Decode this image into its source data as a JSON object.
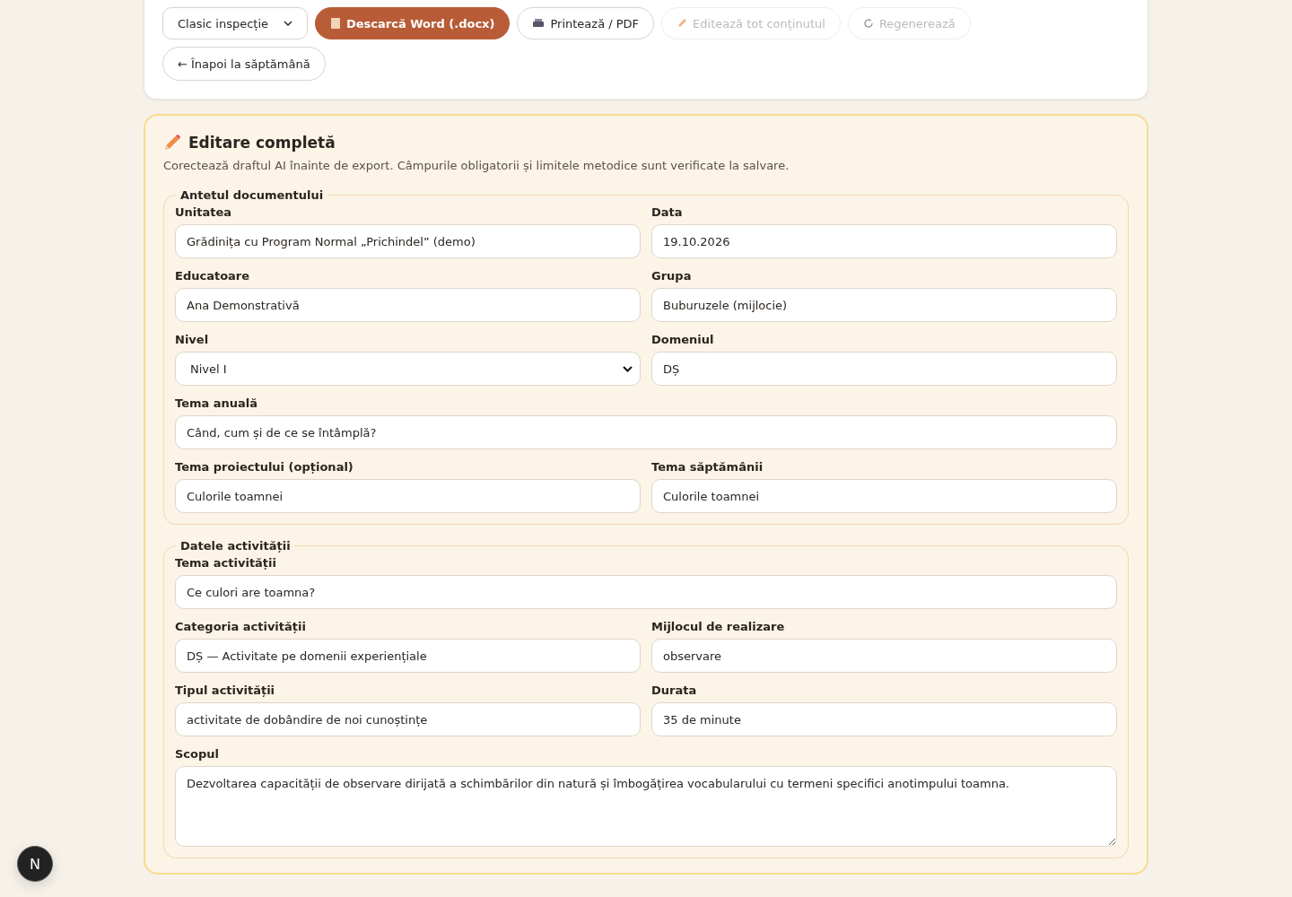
{
  "toolbar": {
    "select": "Clasic inspecție",
    "buttons": [
      {
        "label": "Descarcă Word (.docx)",
        "kind": "primary",
        "disabled": false
      },
      {
        "label": "Printează / PDF",
        "kind": "print",
        "disabled": false
      },
      {
        "label": "Editează tot conținutul",
        "kind": "edit",
        "disabled": true
      },
      {
        "label": "Regenerează",
        "kind": "regen",
        "disabled": true
      }
    ],
    "back": "← Înapoi la săptămână"
  },
  "editor": {
    "title": "Editare completă",
    "subtitle": "Corectează draftul AI înainte de export. Câmpurile obligatorii și limitele metodice sunt verificate la salvare.",
    "sections": [
      {
        "legend": "Antetul documentului",
        "fields": [
          {
            "label": "Unitatea",
            "value": "Grădinița cu Program Normal „Prichindel” (demo)",
            "kind": "input",
            "wide": false
          },
          {
            "label": "Data",
            "value": "19.10.2026",
            "kind": "input",
            "wide": false
          },
          {
            "label": "Educatoare",
            "value": "Ana Demonstrativă",
            "kind": "input",
            "wide": false
          },
          {
            "label": "Grupa",
            "value": "Buburuzele (mijlocie)",
            "kind": "input",
            "wide": false
          },
          {
            "label": "Nivel",
            "value": "Nivel I",
            "kind": "select",
            "wide": false
          },
          {
            "label": "Domeniul",
            "value": "DȘ",
            "kind": "input",
            "wide": false
          },
          {
            "label": "Tema anuală",
            "value": "Când, cum și de ce se întâmplă?",
            "kind": "input",
            "wide": true
          },
          {
            "label": "Tema proiectului (opțional)",
            "value": "Culorile toamnei",
            "kind": "input",
            "wide": false
          },
          {
            "label": "Tema săptămânii",
            "value": "Culorile toamnei",
            "kind": "input",
            "wide": false
          }
        ]
      },
      {
        "legend": "Datele activității",
        "fields": [
          {
            "label": "Tema activității",
            "value": "Ce culori are toamna?",
            "kind": "input",
            "wide": true
          },
          {
            "label": "Categoria activității",
            "value": "DȘ — Activitate pe domenii experiențiale",
            "kind": "input",
            "wide": false
          },
          {
            "label": "Mijlocul de realizare",
            "value": "observare",
            "kind": "input",
            "wide": false
          },
          {
            "label": "Tipul activității",
            "value": "activitate de dobândire de noi cunoștințe",
            "kind": "input",
            "wide": false
          },
          {
            "label": "Durata",
            "value": "35 de minute",
            "kind": "input",
            "wide": false
          },
          {
            "label": "Scopul",
            "value": "Dezvoltarea capacității de observare dirijată a schimbărilor din natură și îmbogățirea vocabularului cu termeni specifici anotimpului toamna.",
            "kind": "textarea",
            "wide": true
          }
        ]
      }
    ]
  },
  "dev_badge": "N"
}
